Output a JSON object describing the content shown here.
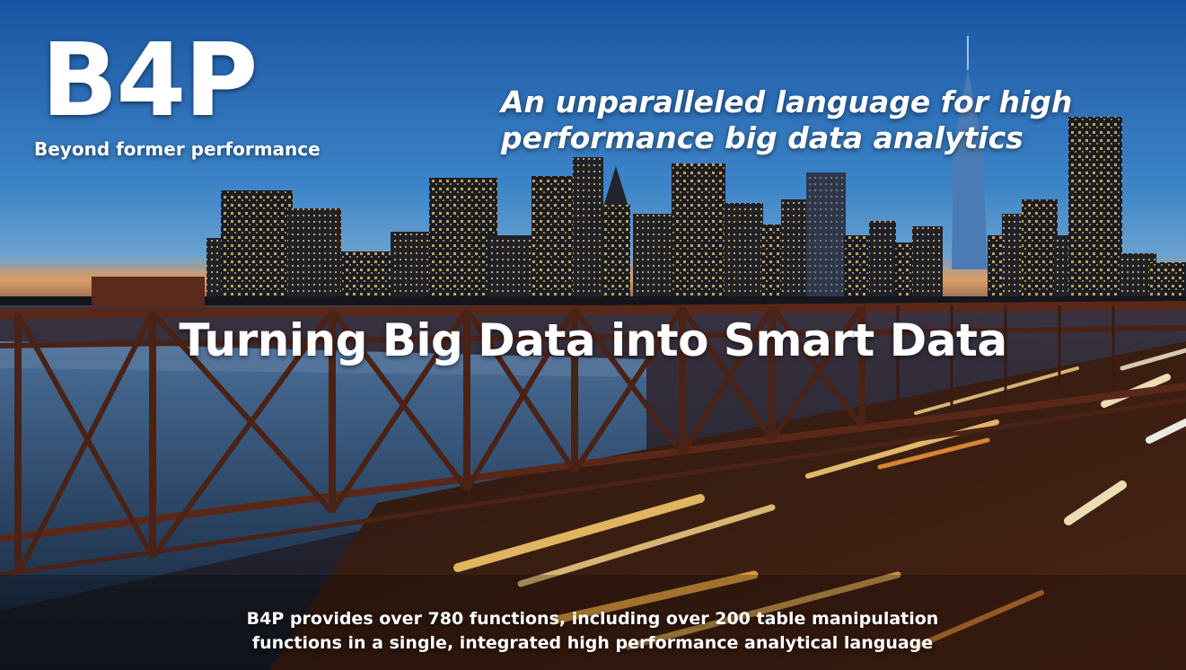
{
  "brand": {
    "logo": "B4P",
    "tagline": "Beyond former performance"
  },
  "headline": {
    "line1": "An unparalleled language for high",
    "line2": "performance big data analytics"
  },
  "center_title": "Turning Big Data into Smart Data",
  "footer": {
    "line1": "B4P provides over 780 functions, including over 200 table manipulation",
    "line2": "functions in a single, integrated high performance analytical language"
  },
  "colors": {
    "sky_top": "#1c58a6",
    "sky_mid": "#3f86c8",
    "horizon": "#e08c4e",
    "water": "#2b4e78",
    "bridge": "#4a1e12",
    "light_trail": "#ffb648"
  },
  "icons": [
    "city-skyline-image",
    "bridge-image",
    "light-trails-image"
  ]
}
